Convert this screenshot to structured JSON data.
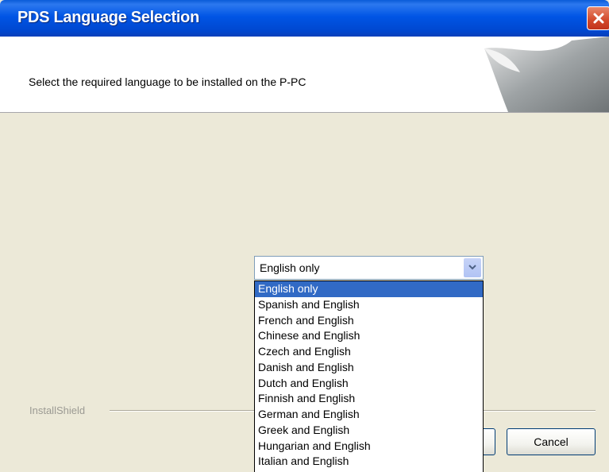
{
  "window": {
    "title": "PDS Language Selection"
  },
  "header": {
    "instruction": "Select the required language to be installed on the P-PC"
  },
  "language_select": {
    "value": "English only",
    "options": [
      "English only",
      "Spanish and English",
      "French and English",
      "Chinese and English",
      "Czech and English",
      "Danish and English",
      "Dutch and English",
      "Finnish and English",
      "German and English",
      "Greek and English",
      "Hungarian and English",
      "Italian and English"
    ],
    "selected_index": 0
  },
  "footer": {
    "brand": "InstallShield",
    "cancel_label": "Cancel",
    "next_label": ""
  },
  "colors": {
    "titlebar": "#0055e5",
    "selection": "#316ac5",
    "face": "#ece9d8"
  }
}
